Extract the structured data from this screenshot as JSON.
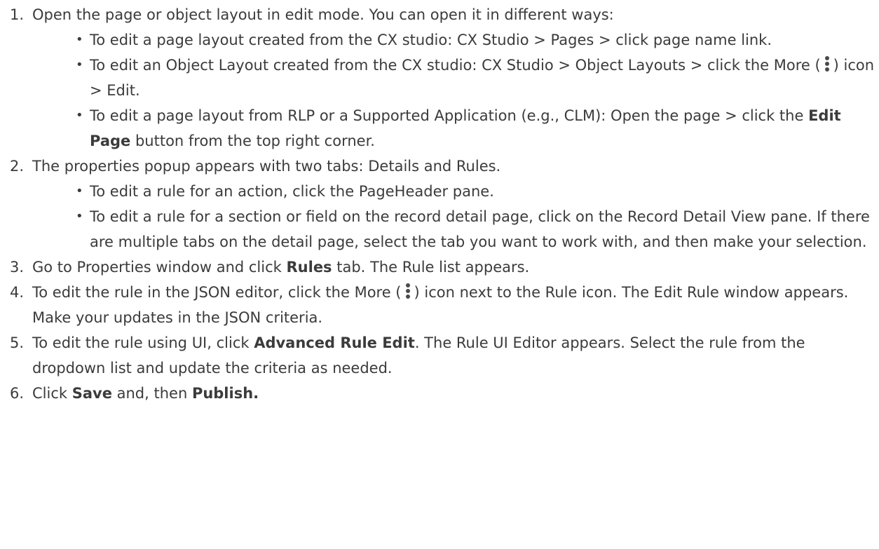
{
  "steps": [
    {
      "num": "1.",
      "text": "Open the page or object layout in edit mode. You can open it in different ways:",
      "bullets": [
        {
          "a": "To edit a page layout created from the CX studio: CX Studio > Pages > click page name link."
        },
        {
          "a": "To edit an Object Layout created from the CX studio: CX Studio > Object Layouts > click the More (",
          "b": ") icon > Edit."
        },
        {
          "a": "To edit a page layout from RLP or a Supported Application (e.g., CLM): Open the page > click the ",
          "bold": "Edit Page",
          "b": " button from the top right corner."
        }
      ]
    },
    {
      "num": "2.",
      "text": "The properties popup appears with two tabs: Details and Rules.",
      "bullets": [
        {
          "a": "To edit a rule for an action, click the PageHeader pane."
        },
        {
          "a": "To edit a rule for a section or field on the record detail page, click on the Record Detail View pane. If there are multiple tabs on the detail page, select the tab you want to work with, and then make your selection."
        }
      ]
    },
    {
      "num": "3.",
      "a": "Go to Properties window and click ",
      "bold": "Rules",
      "b": " tab. The Rule list appears."
    },
    {
      "num": "4.",
      "a": "To edit the rule in the JSON editor, click the More (",
      "b": ") icon next to the Rule icon. The Edit Rule window appears. Make your updates in the JSON criteria."
    },
    {
      "num": "5.",
      "a": "To edit the rule using UI, click ",
      "bold": "Advanced Rule Edit",
      "b": ". The Rule UI Editor appears. Select the rule from the dropdown list and update the criteria as needed."
    },
    {
      "num": "6.",
      "a": "Click ",
      "bold": "Save",
      "b": " and, then ",
      "bold2": "Publish."
    }
  ],
  "bullet_char": "•",
  "icons": {
    "more": "more-vertical-icon"
  },
  "colors": {
    "text": "#3b3b3b"
  }
}
